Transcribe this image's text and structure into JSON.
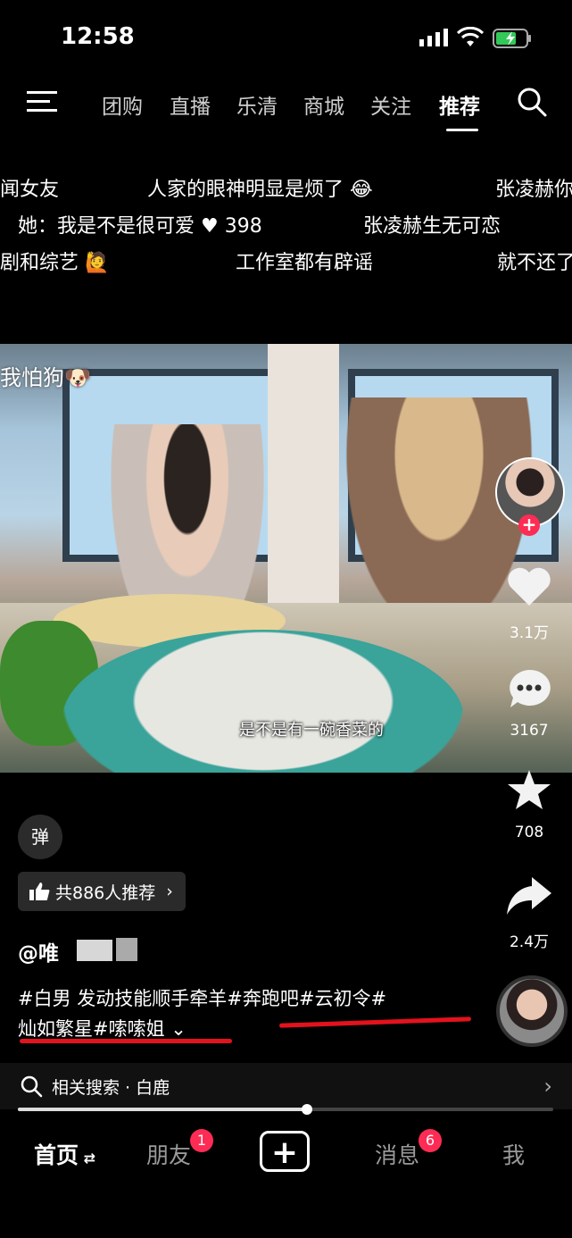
{
  "status_bar": {
    "time": "12:58"
  },
  "nav": {
    "tabs": [
      {
        "label": "团购"
      },
      {
        "label": "直播"
      },
      {
        "label": "乐清"
      },
      {
        "label": "商城"
      },
      {
        "label": "关注"
      },
      {
        "label": "推荐",
        "active": true
      }
    ]
  },
  "danmaku": [
    "闻女友",
    "人家的眼神明显是烦了",
    "张凌赫你",
    "她：我是不是很可爱",
    "398",
    "张凌赫生无可恋",
    "剧和综艺",
    "工作室都有辟谣",
    "就不还了"
  ],
  "video": {
    "watermark": "我怕狗",
    "subtitle": "是不是有一碗香菜的"
  },
  "rail": {
    "likes": "3.1万",
    "comments": "3167",
    "favorites": "708",
    "shares": "2.4万"
  },
  "info": {
    "danmu_toggle": "弹",
    "recommend": "共886人推荐",
    "username": "@唯",
    "desc_line1": "#白男 发动技能顺手牵羊#奔跑吧#云初令#",
    "desc_line2": "灿如繁星#嗦嗦姐"
  },
  "related": {
    "label": "相关搜索 · 白鹿"
  },
  "progress": {
    "fraction": 0.54
  },
  "tabbar": {
    "home": "首页",
    "friends": "朋友",
    "friends_badge": "1",
    "messages": "消息",
    "messages_badge": "6",
    "me": "我"
  },
  "colors": {
    "accent_red": "#fe2c55",
    "underline_red": "#e4121d"
  }
}
